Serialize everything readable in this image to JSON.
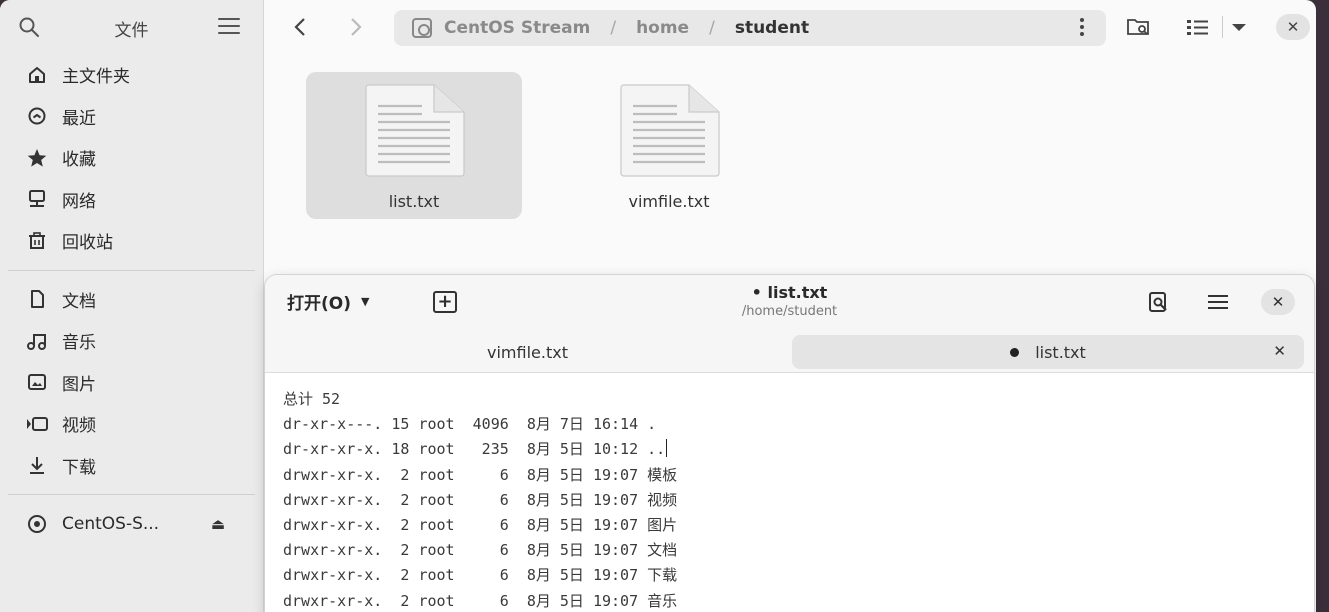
{
  "sidebar": {
    "title": "文件",
    "places": [
      {
        "label": "主文件夹",
        "icon": "home-icon"
      },
      {
        "label": "最近",
        "icon": "clock-icon"
      },
      {
        "label": "收藏",
        "icon": "star-icon"
      },
      {
        "label": "网络",
        "icon": "network-icon"
      },
      {
        "label": "回收站",
        "icon": "trash-icon"
      }
    ],
    "bookmarks": [
      {
        "label": "文档",
        "icon": "document-icon"
      },
      {
        "label": "音乐",
        "icon": "music-icon"
      },
      {
        "label": "图片",
        "icon": "picture-icon"
      },
      {
        "label": "视频",
        "icon": "video-icon"
      },
      {
        "label": "下载",
        "icon": "download-icon"
      }
    ],
    "devices": [
      {
        "label": "CentOS-S...",
        "icon": "disc-icon"
      }
    ]
  },
  "pathbar": {
    "segments": [
      "CentOS Stream",
      "home",
      "student"
    ]
  },
  "files": [
    {
      "name": "list.txt",
      "selected": true
    },
    {
      "name": "vimfile.txt",
      "selected": false
    }
  ],
  "editor": {
    "open_label": "打开(O)",
    "title": "• list.txt",
    "path": "/home/student",
    "tabs": [
      {
        "label": "vimfile.txt",
        "active": false
      },
      {
        "label": "list.txt",
        "active": true,
        "modified": true
      }
    ],
    "lines": [
      "总计 52",
      "dr-xr-x---. 15 root  4096  8月 7日 16:14 .",
      "dr-xr-xr-x. 18 root   235  8月 5日 10:12 ..",
      "drwxr-xr-x.  2 root     6  8月 5日 19:07 模板",
      "drwxr-xr-x.  2 root     6  8月 5日 19:07 视频",
      "drwxr-xr-x.  2 root     6  8月 5日 19:07 图片",
      "drwxr-xr-x.  2 root     6  8月 5日 19:07 文档",
      "drwxr-xr-x.  2 root     6  8月 5日 19:07 下载",
      "drwxr-xr-x.  2 root     6  8月 5日 19:07 音乐"
    ]
  },
  "colors": {
    "sidebar_bg": "#ebebeb",
    "selection_bg": "#dedede",
    "window_bg": "#fafafa"
  }
}
